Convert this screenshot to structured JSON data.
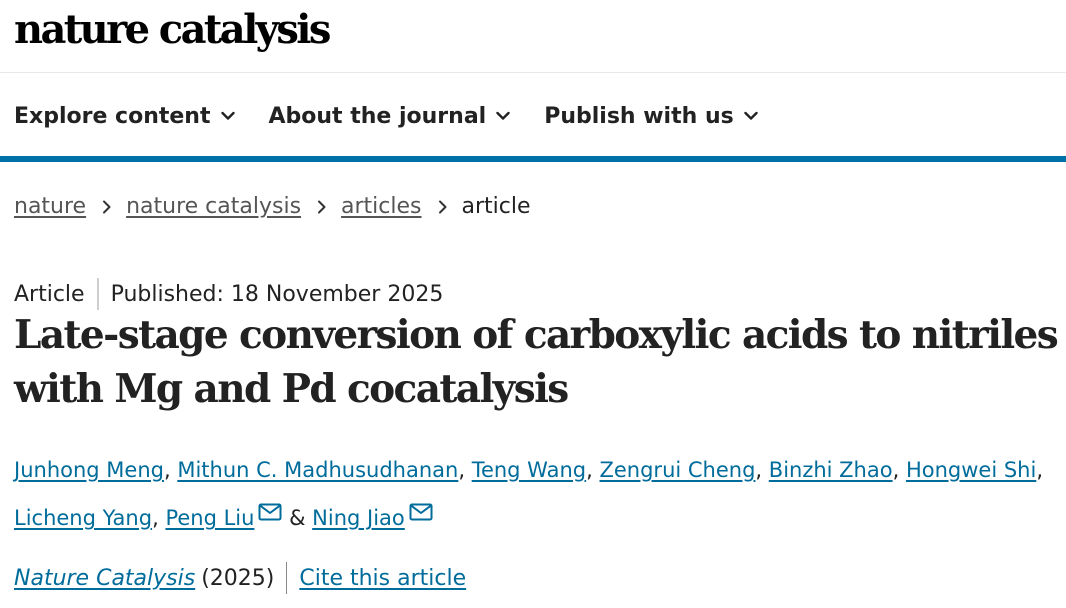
{
  "header": {
    "logo_text": "nature catalysis"
  },
  "nav": {
    "items": [
      {
        "label": "Explore content"
      },
      {
        "label": "About the journal"
      },
      {
        "label": "Publish with us"
      }
    ]
  },
  "colors": {
    "accent": "#0070a8",
    "link": "#006c9b"
  },
  "breadcrumb": {
    "items": [
      {
        "label": "nature"
      },
      {
        "label": "nature catalysis"
      },
      {
        "label": "articles"
      }
    ],
    "current": "article"
  },
  "article": {
    "type": "Article",
    "published": "Published: 18 November 2025",
    "title": "Late-stage conversion of carboxylic acids to nitriles with Mg and Pd cocatalysis",
    "authors": [
      "Junhong Meng",
      "Mithun C. Madhusudhanan",
      "Teng Wang",
      "Zengrui Cheng",
      "Binzhi Zhao",
      "Hongwei Shi",
      "Licheng Yang",
      "Peng Liu",
      "Ning Jiao"
    ],
    "author_separator": ", ",
    "author_ampersand": " & ",
    "corresponding_icon": "envelope-icon",
    "journal": "Nature Catalysis",
    "year": "(2025)",
    "cite_label": "Cite this article"
  }
}
